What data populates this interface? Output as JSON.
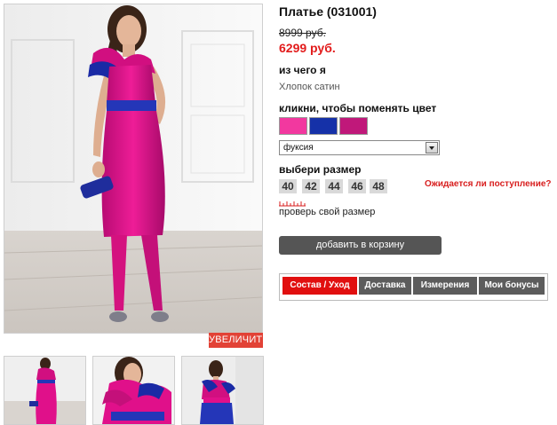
{
  "product": {
    "title": "Платье (031001)",
    "old_price": "8999 руб.",
    "new_price": "6299 руб."
  },
  "material": {
    "label": "из чего я",
    "value": "Хлопок сатин"
  },
  "colors": {
    "label": "кликни, чтобы поменять цвет",
    "swatches": [
      {
        "color": "#f2389f"
      },
      {
        "color": "#1531a8"
      },
      {
        "color": "#c0187a"
      }
    ],
    "selected": "фуксия"
  },
  "sizes": {
    "label": "выбери размер",
    "items": [
      "40",
      "42",
      "44",
      "46",
      "48"
    ],
    "waiting_link": "Ожидается ли поступление?",
    "check_size": "проверь свой размер"
  },
  "actions": {
    "zoom": "УВЕЛИЧИТЬ",
    "add_to_cart": "добавить в корзину"
  },
  "tabs": [
    {
      "label": "Состав / Уход",
      "active": true
    },
    {
      "label": "Доставка",
      "active": false
    },
    {
      "label": "Измерения",
      "active": false
    },
    {
      "label": "Мои бонусы",
      "active": false
    }
  ],
  "colors_theme": {
    "accent_red": "#e10f0f",
    "button_gray": "#555555",
    "dress_fuchsia": "#e0108a",
    "dress_blue": "#1f2fb0"
  }
}
